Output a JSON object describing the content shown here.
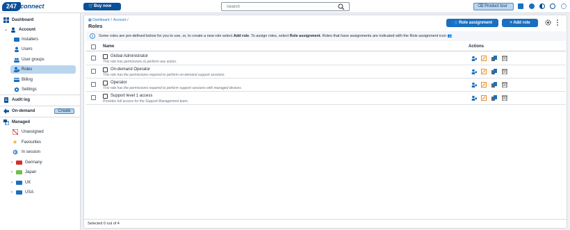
{
  "header": {
    "logo_num": "247",
    "logo_word": "connect",
    "buy_now": "Buy now",
    "search_placeholder": "Search",
    "product_tour": "Product tour",
    "icons": [
      "announcement-icon",
      "notification-icon",
      "contrast-icon",
      "help-icon",
      "settings-icon"
    ]
  },
  "sidebar": {
    "dashboard": "Dashboard",
    "account": "Account",
    "account_items": [
      "Installers",
      "Users",
      "User groups",
      "Roles",
      "Billing",
      "Settings"
    ],
    "audit_log": "Audit log",
    "on_demand": "On-demand",
    "create": "Create",
    "managed": "Managed",
    "managed_items": [
      "Unassigned",
      "Favourites",
      "In session"
    ],
    "groups": [
      {
        "label": "Germany",
        "color": "#d32f2f"
      },
      {
        "label": "Japan",
        "color": "#6cc04a"
      },
      {
        "label": "UK",
        "color": "#1a6fc0"
      },
      {
        "label": "USA",
        "color": "#1a6fc0"
      }
    ]
  },
  "main": {
    "breadcrumb_home": "Dashboard",
    "breadcrumb_account": "Account",
    "breadcrumb_sep": "/",
    "title": "Roles",
    "role_assignment_btn": "Role assignment",
    "add_role_btn": "Add role",
    "info": {
      "part1": "Some roles are pre-defined below for you to use, or, to create a new role select ",
      "b1": "Add role",
      "part2": ". To assign roles, select ",
      "b2": "Role assignment",
      "part3": ". Roles that have assignments are indicated with the Role assignment icon"
    },
    "col_name": "Name",
    "col_actions": "Actions",
    "rows": [
      {
        "name": "Global Administrator",
        "desc": "This role has permissions to perform any action."
      },
      {
        "name": "On-demand Operator",
        "desc": "This role has the permissions required to perform on-demand support sessions."
      },
      {
        "name": "Operator",
        "desc": "This role has the permissions required to perform support sessions with managed devices."
      },
      {
        "name": "Support level 1 access",
        "desc": "Provides full access for the Support Management team."
      }
    ],
    "footer": "Selected 0 out of 4"
  },
  "colors": {
    "brand": "#0a4f98",
    "primary": "#1a6fc0",
    "active_bg": "#b9d6ef",
    "edit_orange": "#f08a24"
  }
}
